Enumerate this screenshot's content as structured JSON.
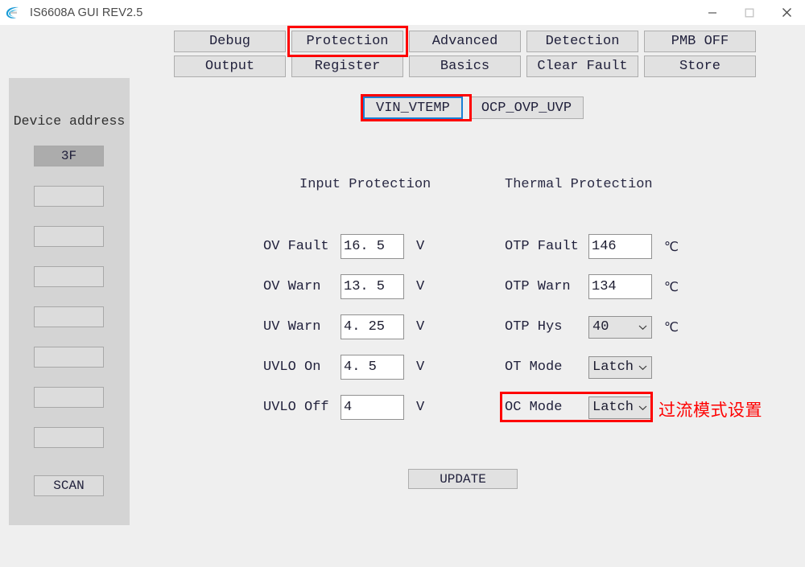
{
  "window": {
    "title": "IS6608A GUI REV2.5",
    "icon": "app-logo-icon",
    "controls": {
      "minimize": "minimize-icon",
      "maximize": "maximize-icon",
      "close": "close-icon"
    }
  },
  "sidebar": {
    "title": "Device address",
    "items": [
      {
        "label": "3F",
        "selected": true
      },
      {
        "label": "",
        "selected": false
      },
      {
        "label": "",
        "selected": false
      },
      {
        "label": "",
        "selected": false
      },
      {
        "label": "",
        "selected": false
      },
      {
        "label": "",
        "selected": false
      },
      {
        "label": "",
        "selected": false
      },
      {
        "label": "",
        "selected": false
      }
    ],
    "scan_label": "SCAN"
  },
  "toolbar": {
    "row1": [
      "Debug",
      "Protection",
      "Advanced",
      "Detection",
      "PMB OFF"
    ],
    "row2": [
      "Output",
      "Register",
      "Basics",
      "Clear Fault",
      "Store"
    ],
    "active": "Protection"
  },
  "subtabs": {
    "items": [
      "VIN_VTEMP",
      "OCP_OVP_UVP"
    ],
    "active": "VIN_VTEMP"
  },
  "input_protection": {
    "heading": "Input Protection",
    "rows": [
      {
        "label": "OV Fault",
        "value": "16. 5",
        "unit": "V"
      },
      {
        "label": "OV Warn",
        "value": "13. 5",
        "unit": "V"
      },
      {
        "label": "UV Warn",
        "value": "4. 25",
        "unit": "V"
      },
      {
        "label": "UVLO On",
        "value": "4. 5",
        "unit": "V"
      },
      {
        "label": "UVLO Off",
        "value": "4",
        "unit": "V"
      }
    ]
  },
  "thermal_protection": {
    "heading": "Thermal Protection",
    "rows": [
      {
        "label": "OTP Fault",
        "value": "146",
        "unit": "℃",
        "type": "input"
      },
      {
        "label": "OTP Warn",
        "value": "134",
        "unit": "℃",
        "type": "input"
      },
      {
        "label": "OTP Hys",
        "value": "40",
        "unit": "℃",
        "type": "select"
      },
      {
        "label": "OT Mode",
        "value": "Latch",
        "unit": "",
        "type": "select"
      },
      {
        "label": "OC Mode",
        "value": "Latch",
        "unit": "",
        "type": "select"
      }
    ]
  },
  "update_label": "UPDATE",
  "annotation": {
    "text": "过流模式设置",
    "color": "#fe0000",
    "targets": [
      "Protection",
      "VIN_VTEMP",
      "OC Mode"
    ]
  }
}
